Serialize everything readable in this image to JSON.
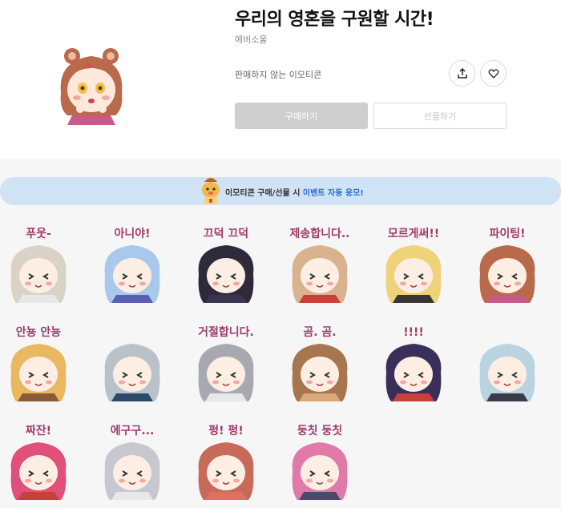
{
  "product": {
    "title": "우리의 영혼을 구원할 시간!",
    "author": "에버소울",
    "notice": "판매하지 않는 이모티콘"
  },
  "actions": {
    "share_icon": "share-icon",
    "like_icon": "heart-icon",
    "buy_label": "구매하기",
    "gift_label": "선물하기"
  },
  "banner": {
    "text_prefix": "이모티콘 구매/선물 시 ",
    "text_highlight": "이벤트 자동 응모!",
    "accent": "#2a6fcf"
  },
  "emoticons": [
    {
      "caption": "푸웃-",
      "hair": "#d9d2c6",
      "outfit": "#e8e8e8"
    },
    {
      "caption": "아니야!",
      "hair": "#a9c9ec",
      "outfit": "#5a5fb4"
    },
    {
      "caption": "끄덕 끄덕",
      "hair": "#2e2a3a",
      "outfit": "#3b3450"
    },
    {
      "caption": "제송합니다..",
      "hair": "#d9b38f",
      "outfit": "#c8403a"
    },
    {
      "caption": "모르게써!!",
      "hair": "#f0d27a",
      "outfit": "#3a3530"
    },
    {
      "caption": "파이팅!",
      "hair": "#b86a4a",
      "outfit": "#c85a8a"
    },
    {
      "caption": "안뇽 안뇽",
      "hair": "#e9b860",
      "outfit": "#8b5a3a"
    },
    {
      "caption": "",
      "hair": "#b9c2c9",
      "outfit": "#2e4a6a"
    },
    {
      "caption": "거절합니다.",
      "hair": "#a8a8b0",
      "outfit": "#e8e8e8"
    },
    {
      "caption": "곰. 곰.",
      "hair": "#a7764f",
      "outfit": "#d9a77a"
    },
    {
      "caption": "!!!!",
      "hair": "#3a2f5a",
      "outfit": "#c8403a"
    },
    {
      "caption": "",
      "hair": "#b9d3e0",
      "outfit": "#3a3a4a"
    },
    {
      "caption": "짜잔!",
      "hair": "#e0507a",
      "outfit": "#c8403a"
    },
    {
      "caption": "에구구...",
      "hair": "#c7c7cf",
      "outfit": "#e8e8e8"
    },
    {
      "caption": "펑! 펑!",
      "hair": "#c86a5a",
      "outfit": "#e07060"
    },
    {
      "caption": "둥칫 둥칫",
      "hair": "#e07aa8",
      "outfit": "#4a4a6a"
    }
  ],
  "colors": {
    "header_bg": "#ffffff",
    "gallery_bg": "#f6f6f6",
    "banner_bg": "#cfe3f5",
    "buy_bg": "#cfcfcf",
    "caption": "#a03a6a"
  }
}
